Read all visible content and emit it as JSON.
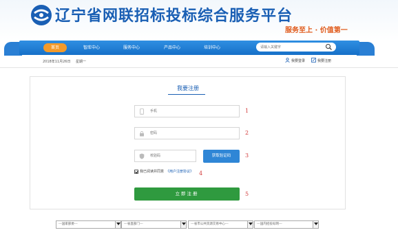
{
  "header": {
    "title": "辽宁省网联招标投标综合服务平台",
    "slogan": "服务至上 · 价值第一",
    "logo_icon": "liaoning-logo-icon"
  },
  "nav": {
    "items": [
      {
        "label": "首页",
        "active": true
      },
      {
        "label": "智库中心"
      },
      {
        "label": "服务中心"
      },
      {
        "label": "产品中心"
      },
      {
        "label": "培训中心"
      }
    ],
    "search_placeholder": "请输入关键字",
    "search_icon": "search-icon"
  },
  "infobar": {
    "date": "2018年11月26日",
    "weekday": "星期一",
    "login_label": "我要登录",
    "register_label": "我要注册"
  },
  "form": {
    "title": "我要注册",
    "phone_placeholder": "手机",
    "password_placeholder": "密码",
    "code_placeholder": "校验码",
    "get_code_label": "获取验证码",
    "agree_text": "我已阅读并同意",
    "agree_link": "《用户注册协议》",
    "agree_checked": true,
    "submit_label": "立即注册",
    "markers": [
      "1",
      "2",
      "3",
      "4",
      "5"
    ]
  },
  "footer": {
    "selects": [
      "---国家部委---",
      "---省直部门---",
      "---省市公共资源交易中心---",
      "---国内招投标网---"
    ]
  },
  "colors": {
    "brand_blue": "#1a5fb4",
    "nav_blue": "#1670c8",
    "nav_active": "#f39a2a",
    "slogan_orange": "#e05a1b",
    "submit_green": "#2f9a3f",
    "marker_red": "#d23b3b"
  }
}
